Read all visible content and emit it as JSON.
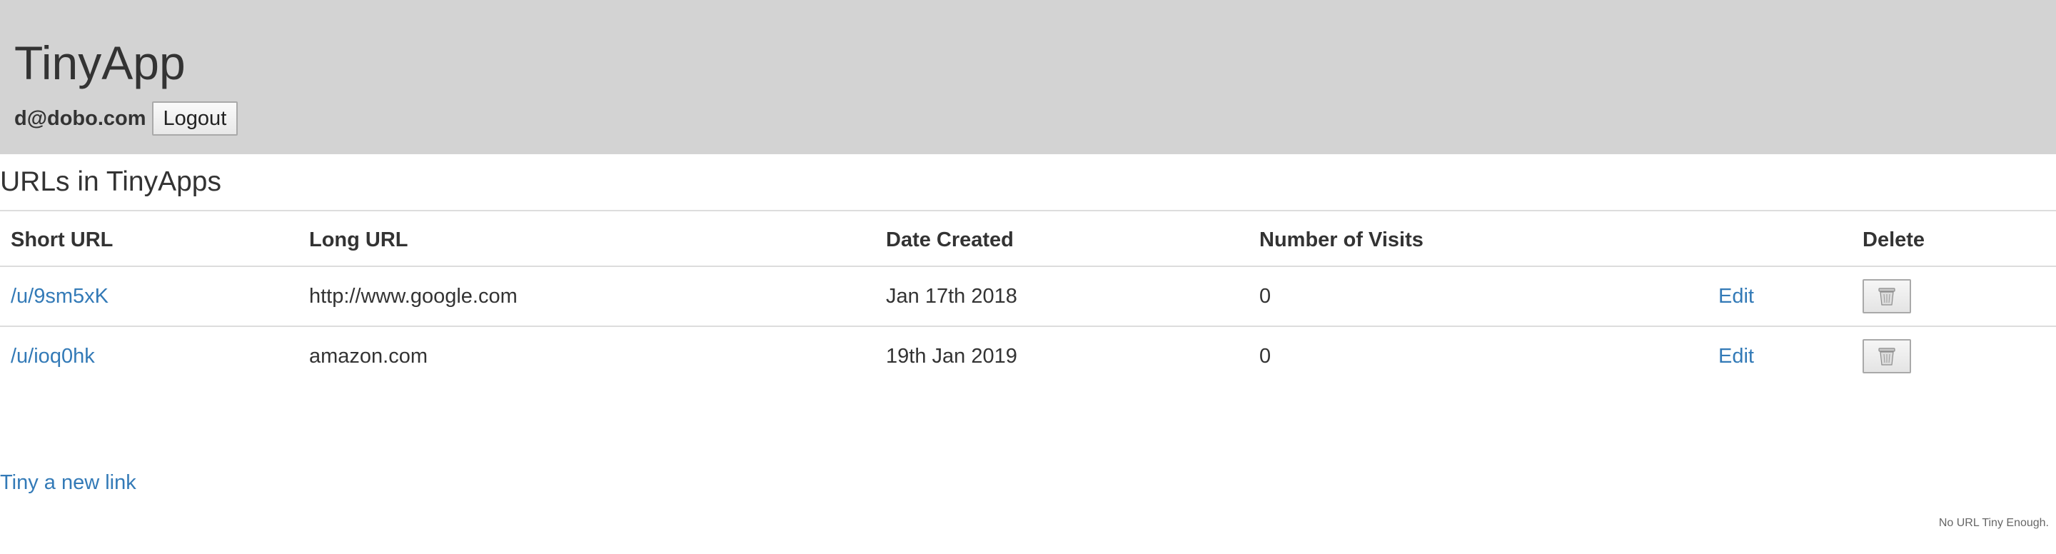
{
  "header": {
    "app_title": "TinyApp",
    "user_email": "d@dobo.com",
    "logout_label": "Logout",
    "background_color": "#d3d3d3"
  },
  "main": {
    "section_title": "URLs in TinyApps",
    "table": {
      "columns": [
        "Short URL",
        "Long URL",
        "Date Created",
        "Number of Visits",
        "",
        "Delete"
      ],
      "rows": [
        {
          "short_url": "/u/9sm5xK",
          "long_url": "http://www.google.com",
          "date_created": "Jan 17th 2018",
          "visits": "0",
          "edit_label": "Edit",
          "delete_icon": "trash-icon"
        },
        {
          "short_url": "/u/ioq0hk",
          "long_url": "amazon.com",
          "date_created": "19th Jan 2019",
          "visits": "0",
          "edit_label": "Edit",
          "delete_icon": "trash-icon"
        }
      ]
    },
    "new_link_label": "Tiny a new link",
    "link_color": "#337ab7"
  },
  "footer": {
    "text": "No URL Tiny Enough."
  }
}
